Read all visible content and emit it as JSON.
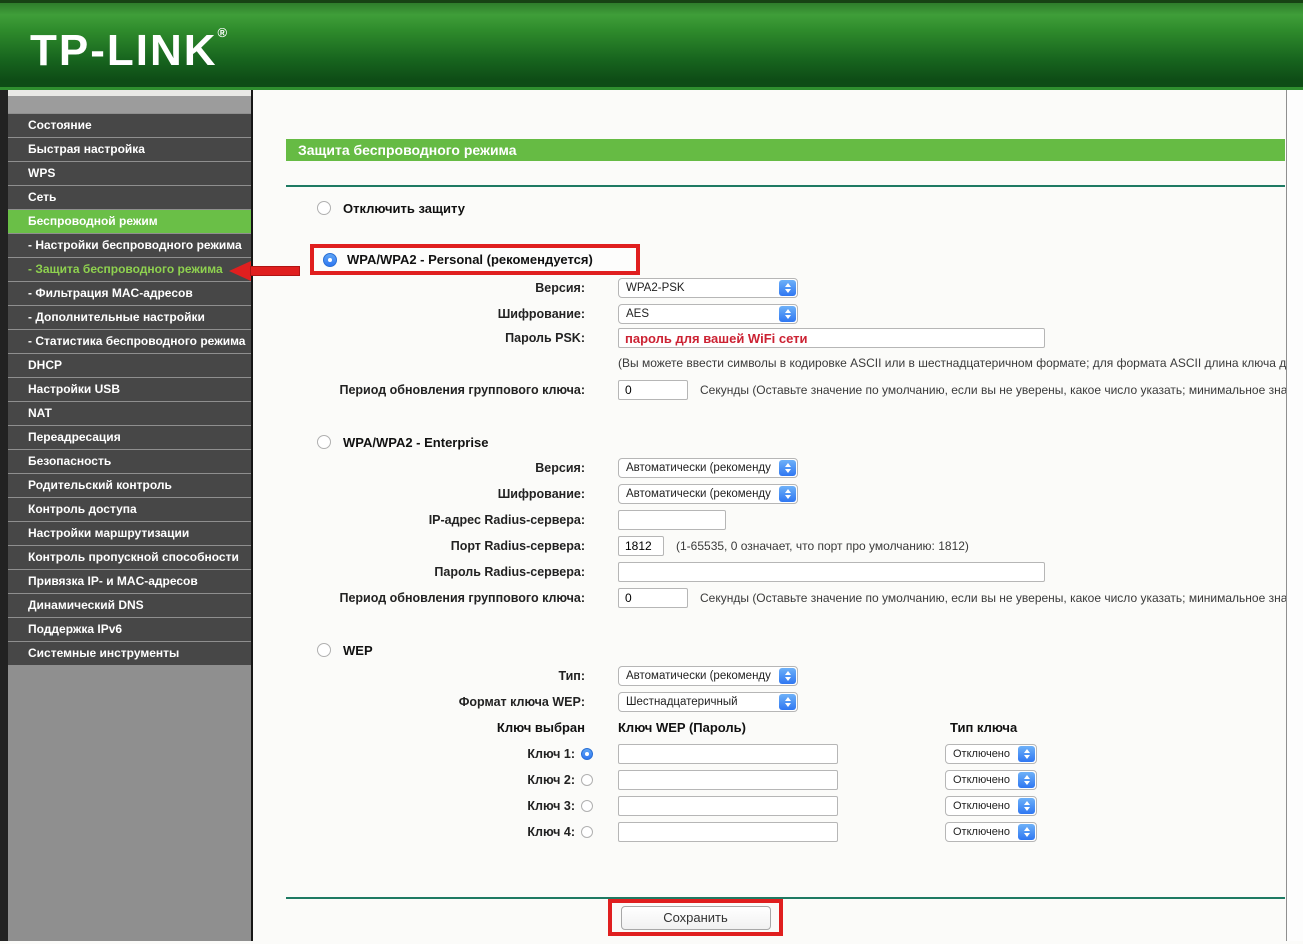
{
  "header": {
    "logo": "TP-LINK",
    "logo_reg": "®"
  },
  "sidebar": {
    "items": [
      {
        "label": "Состояние",
        "state": "normal"
      },
      {
        "label": "Быстрая настройка",
        "state": "normal"
      },
      {
        "label": "WPS",
        "state": "normal"
      },
      {
        "label": "Сеть",
        "state": "normal"
      },
      {
        "label": "Беспроводной режим",
        "state": "active"
      },
      {
        "label": "- Настройки беспроводного режима",
        "state": "sub"
      },
      {
        "label": "- Защита беспроводного режима",
        "state": "sub-active"
      },
      {
        "label": "- Фильтрация MAC-адресов",
        "state": "sub"
      },
      {
        "label": "- Дополнительные настройки",
        "state": "sub"
      },
      {
        "label": "- Статистика беспроводного режима",
        "state": "sub"
      },
      {
        "label": "DHCP",
        "state": "normal"
      },
      {
        "label": "Настройки USB",
        "state": "normal"
      },
      {
        "label": "NAT",
        "state": "normal"
      },
      {
        "label": "Переадресация",
        "state": "normal"
      },
      {
        "label": "Безопасность",
        "state": "normal"
      },
      {
        "label": "Родительский контроль",
        "state": "normal"
      },
      {
        "label": "Контроль доступа",
        "state": "normal"
      },
      {
        "label": "Настройки маршрутизации",
        "state": "normal"
      },
      {
        "label": "Контроль пропускной способности",
        "state": "normal"
      },
      {
        "label": "Привязка IP- и MAC-адресов",
        "state": "normal"
      },
      {
        "label": "Динамический DNS",
        "state": "normal"
      },
      {
        "label": "Поддержка IPv6",
        "state": "normal"
      },
      {
        "label": "Системные инструменты",
        "state": "normal"
      }
    ]
  },
  "page": {
    "title": "Защита беспроводного режима"
  },
  "options": {
    "disable": {
      "label": "Отключить защиту",
      "selected": false
    },
    "personal": {
      "label": "WPA/WPA2 - Personal (рекомендуется)",
      "selected": true
    },
    "enterprise": {
      "label": "WPA/WPA2 - Enterprise",
      "selected": false
    },
    "wep": {
      "label": "WEP",
      "selected": false
    }
  },
  "personal": {
    "version_label": "Версия:",
    "version_value": "WPA2-PSK",
    "cipher_label": "Шифрование:",
    "cipher_value": "AES",
    "psk_label": "Пароль PSK:",
    "psk_value": "пароль для вашей WiFi сети",
    "psk_hint": "(Вы можете ввести символы в кодировке ASCII или в шестнадцатеричном формате; для формата ASCII длина ключа д",
    "gkup_label": "Период обновления группового ключа:",
    "gkup_value": "0",
    "gkup_hint": "Секунды (Оставьте значение по умолчанию, если вы не уверены, какое число указать; минимальное знач"
  },
  "enterprise": {
    "version_label": "Версия:",
    "version_value": "Автоматически (рекоменду",
    "cipher_label": "Шифрование:",
    "cipher_value": "Автоматически (рекоменду",
    "radius_ip_label": "IP-адрес Radius-сервера:",
    "radius_ip_value": "",
    "radius_port_label": "Порт Radius-сервера:",
    "radius_port_value": "1812",
    "radius_port_hint": "(1-65535, 0 означает, что порт про умолчанию: 1812)",
    "radius_pwd_label": "Пароль Radius-сервера:",
    "radius_pwd_value": "",
    "gkup_label": "Период обновления группового ключа:",
    "gkup_value": "0",
    "gkup_hint": "Секунды (Оставьте значение по умолчанию, если вы не уверены, какое число указать; минимальное знач"
  },
  "wep": {
    "type_label": "Тип:",
    "type_value": "Автоматически (рекоменду",
    "format_label": "Формат ключа WEP:",
    "format_value": "Шестнадцатеричный",
    "col_selected": "Ключ выбран",
    "col_key": "Ключ WEP (Пароль)",
    "col_type": "Тип ключа",
    "keys": [
      {
        "label": "Ключ 1:",
        "selected": true,
        "value": "",
        "type": "Отключено"
      },
      {
        "label": "Ключ 2:",
        "selected": false,
        "value": "",
        "type": "Отключено"
      },
      {
        "label": "Ключ 3:",
        "selected": false,
        "value": "",
        "type": "Отключено"
      },
      {
        "label": "Ключ 4:",
        "selected": false,
        "value": "",
        "type": "Отключено"
      }
    ]
  },
  "footer": {
    "save_label": "Сохранить"
  }
}
